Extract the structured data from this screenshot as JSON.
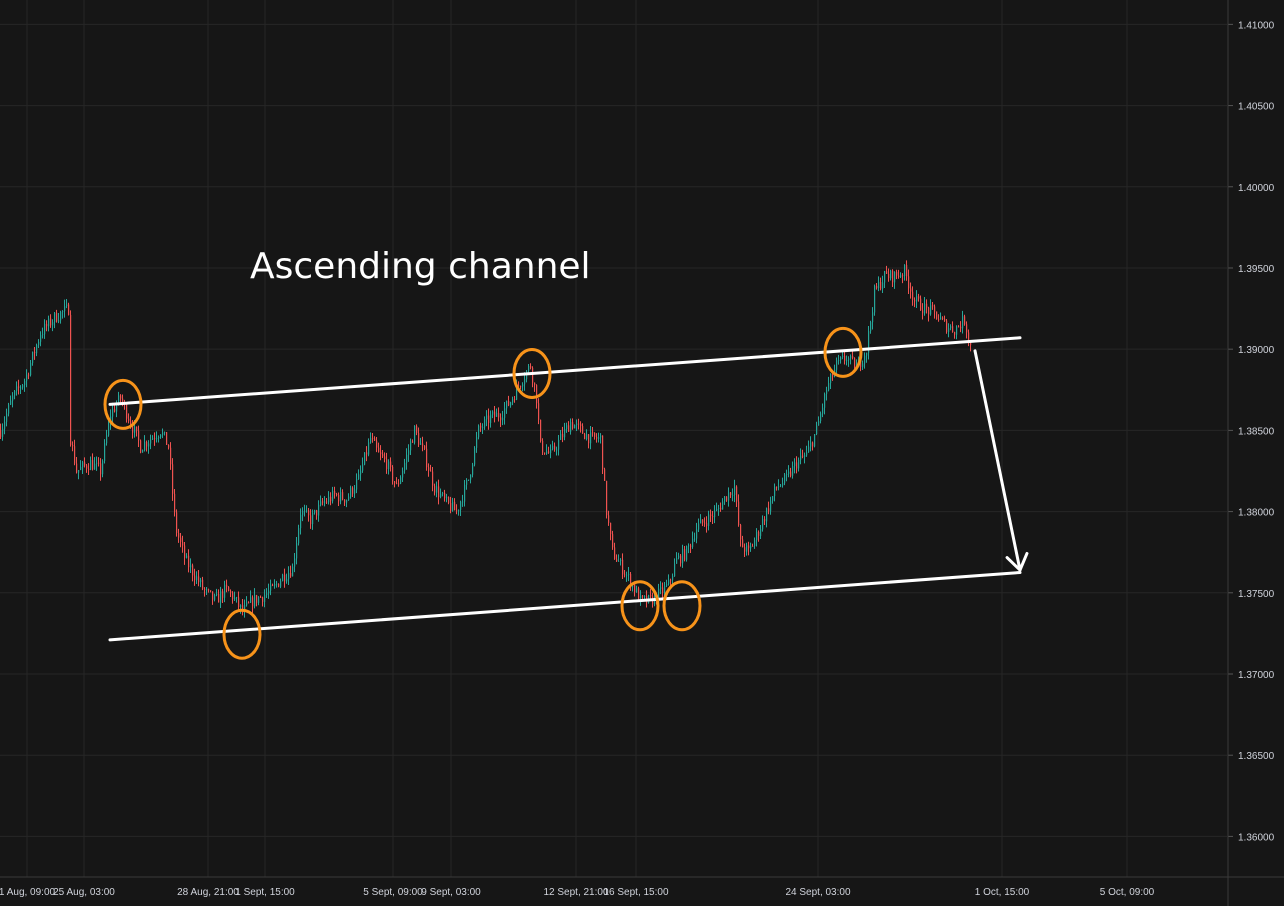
{
  "colors": {
    "background": "#161616",
    "grid": "#262626",
    "up_candle": "#26a69a",
    "down_candle": "#ef5350",
    "channel_line": "#ffffff",
    "touch_marker": "#f7931a",
    "arrow": "#ffffff",
    "axis_text": "#d1d4dc"
  },
  "chart_data": {
    "type": "candlestick",
    "title": "",
    "y_axis": {
      "position": "right",
      "ticks": [
        "1.41000",
        "1.40500",
        "1.40000",
        "1.39500",
        "1.39000",
        "1.38500",
        "1.38000",
        "1.37500",
        "1.37000",
        "1.36500",
        "1.36000"
      ],
      "ylim": [
        1.3575,
        1.4115
      ]
    },
    "x_axis": {
      "ticks": [
        "1 Aug, 09:00",
        "25 Aug, 03:00",
        "28 Aug, 21:00",
        "1 Sept, 15:00",
        "5 Sept, 09:00",
        "9 Sept, 03:00",
        "12 Sept, 21:00",
        "16 Sept, 15:00",
        "24 Sept, 03:00",
        "1 Oct, 15:00",
        "5 Oct, 09:00"
      ],
      "xlim": [
        0,
        1227
      ]
    },
    "price_path": [
      [
        0,
        1.385
      ],
      [
        12,
        1.387
      ],
      [
        25,
        1.3882
      ],
      [
        40,
        1.391
      ],
      [
        55,
        1.392
      ],
      [
        68,
        1.3925
      ],
      [
        70,
        1.3845
      ],
      [
        76,
        1.3825
      ],
      [
        90,
        1.383
      ],
      [
        100,
        1.3825
      ],
      [
        110,
        1.386
      ],
      [
        120,
        1.387
      ],
      [
        130,
        1.3855
      ],
      [
        140,
        1.384
      ],
      [
        150,
        1.3845
      ],
      [
        160,
        1.385
      ],
      [
        168,
        1.384
      ],
      [
        175,
        1.379
      ],
      [
        185,
        1.377
      ],
      [
        195,
        1.376
      ],
      [
        205,
        1.375
      ],
      [
        215,
        1.3745
      ],
      [
        225,
        1.3752
      ],
      [
        232,
        1.3748
      ],
      [
        242,
        1.3738
      ],
      [
        252,
        1.3745
      ],
      [
        262,
        1.3748
      ],
      [
        272,
        1.3752
      ],
      [
        282,
        1.376
      ],
      [
        292,
        1.3765
      ],
      [
        300,
        1.38
      ],
      [
        310,
        1.3795
      ],
      [
        322,
        1.3805
      ],
      [
        334,
        1.381
      ],
      [
        346,
        1.3808
      ],
      [
        358,
        1.382
      ],
      [
        370,
        1.3845
      ],
      [
        378,
        1.3835
      ],
      [
        386,
        1.383
      ],
      [
        396,
        1.3815
      ],
      [
        404,
        1.383
      ],
      [
        414,
        1.385
      ],
      [
        424,
        1.3835
      ],
      [
        434,
        1.3815
      ],
      [
        446,
        1.3805
      ],
      [
        456,
        1.38
      ],
      [
        468,
        1.382
      ],
      [
        478,
        1.385
      ],
      [
        490,
        1.3858
      ],
      [
        500,
        1.386
      ],
      [
        510,
        1.3868
      ],
      [
        520,
        1.388
      ],
      [
        530,
        1.389
      ],
      [
        536,
        1.387
      ],
      [
        540,
        1.384
      ],
      [
        550,
        1.3835
      ],
      [
        560,
        1.3845
      ],
      [
        570,
        1.3855
      ],
      [
        580,
        1.385
      ],
      [
        590,
        1.3845
      ],
      [
        600,
        1.3845
      ],
      [
        606,
        1.38
      ],
      [
        612,
        1.3775
      ],
      [
        622,
        1.3765
      ],
      [
        632,
        1.3755
      ],
      [
        640,
        1.3745
      ],
      [
        650,
        1.3745
      ],
      [
        660,
        1.375
      ],
      [
        668,
        1.3755
      ],
      [
        676,
        1.377
      ],
      [
        686,
        1.3775
      ],
      [
        696,
        1.379
      ],
      [
        706,
        1.3795
      ],
      [
        716,
        1.38
      ],
      [
        726,
        1.381
      ],
      [
        734,
        1.3815
      ],
      [
        740,
        1.378
      ],
      [
        748,
        1.3775
      ],
      [
        756,
        1.3785
      ],
      [
        766,
        1.38
      ],
      [
        776,
        1.3815
      ],
      [
        786,
        1.382
      ],
      [
        796,
        1.383
      ],
      [
        806,
        1.3835
      ],
      [
        816,
        1.385
      ],
      [
        826,
        1.3875
      ],
      [
        836,
        1.389
      ],
      [
        846,
        1.3895
      ],
      [
        856,
        1.3888
      ],
      [
        866,
        1.39
      ],
      [
        874,
        1.3935
      ],
      [
        884,
        1.3945
      ],
      [
        894,
        1.3945
      ],
      [
        904,
        1.3948
      ],
      [
        914,
        1.393
      ],
      [
        924,
        1.3925
      ],
      [
        934,
        1.3922
      ],
      [
        944,
        1.3915
      ],
      [
        954,
        1.3912
      ],
      [
        964,
        1.3918
      ],
      [
        970,
        1.3902
      ]
    ],
    "annotations": {
      "label": "Ascending channel",
      "upper_line": [
        [
          110,
          1.3866
        ],
        [
          1020,
          1.3907
        ]
      ],
      "lower_line": [
        [
          110,
          1.3721
        ],
        [
          1020,
          1.37625
        ]
      ],
      "touch_points": [
        [
          123,
          1.3866
        ],
        [
          532,
          1.3885
        ],
        [
          843,
          1.3898
        ],
        [
          242,
          1.37245
        ],
        [
          640,
          1.3742
        ],
        [
          682,
          1.3742
        ]
      ],
      "projection_arrow": [
        [
          975,
          1.3899
        ],
        [
          1020,
          1.3764
        ]
      ]
    }
  }
}
